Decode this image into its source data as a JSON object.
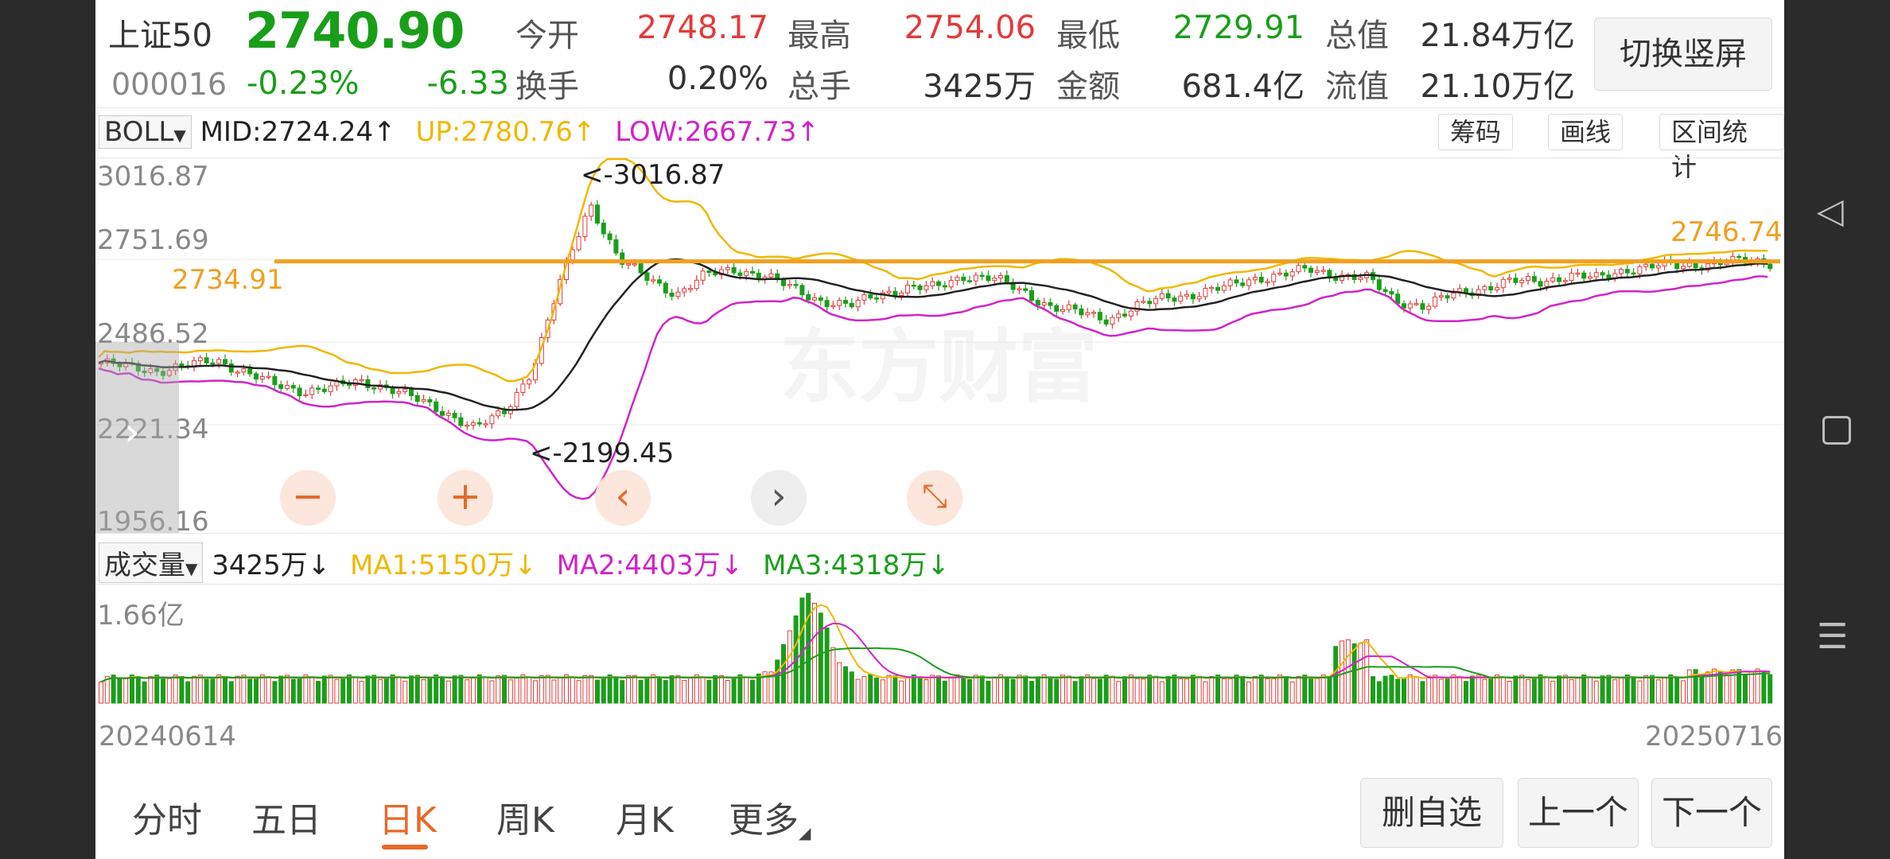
{
  "stock": {
    "name": "上证50",
    "price": "2740.90",
    "code": "000016",
    "change_pct": "-0.23%",
    "change": "-6.33",
    "stats": [
      {
        "label": "今开",
        "value": "2748.17",
        "color": "#e33a3a"
      },
      {
        "label": "最高",
        "value": "2754.06",
        "color": "#e33a3a"
      },
      {
        "label": "最低",
        "value": "2729.91",
        "color": "#1a9e1a"
      },
      {
        "label": "总值",
        "value": "21.84万亿",
        "color": "#333333"
      },
      {
        "label": "换手",
        "value": "0.20%",
        "color": "#333333"
      },
      {
        "label": "总手",
        "value": "3425万",
        "color": "#333333"
      },
      {
        "label": "金额",
        "value": "681.4亿",
        "color": "#333333"
      },
      {
        "label": "流值",
        "value": "21.10万亿",
        "color": "#333333"
      }
    ],
    "switch_label": "切换竖屏"
  },
  "indicator": {
    "selector": "BOLL",
    "mid": "MID:2724.24",
    "up": "UP:2780.76",
    "low": "LOW:2667.73",
    "arrow_up": "↑",
    "buttons": [
      "筹码",
      "画线",
      "区间统计"
    ]
  },
  "kchart": {
    "y_ticks": [
      "3016.87",
      "2751.69",
      "2486.52",
      "2221.34",
      "1956.16"
    ],
    "high_label": "<-3016.87",
    "low_label": "<-2199.45",
    "hline_left": "2734.91",
    "hline_right": "2746.74",
    "watermark": "东方财富"
  },
  "volume": {
    "selector": "成交量",
    "value": "3425万",
    "ma1": "MA1:5150万",
    "ma2": "MA2:4403万",
    "ma3": "MA3:4318万",
    "arrow_down": "↓",
    "y_top": "1.66亿",
    "date_start": "20240614",
    "date_end": "20250716"
  },
  "controls": {
    "zoom_out": "−",
    "zoom_in": "+",
    "prev": "‹",
    "next": "›",
    "collapse": "⤡"
  },
  "tabs": [
    "分时",
    "五日",
    "日K",
    "周K",
    "月K",
    "更多"
  ],
  "active_tab": "日K",
  "actions": {
    "remove": "删自选",
    "prev": "上一个",
    "next": "下一个"
  },
  "colors": {
    "up": "#e33a3a",
    "down": "#1a9e1a",
    "accent": "#e8692a",
    "mid": "#222222",
    "upper": "#f0b800",
    "lower": "#d024c8",
    "hline": "#f0a020"
  },
  "chart_data": {
    "type": "candlestick",
    "x_range": [
      "20240614",
      "20250716"
    ],
    "ylim": [
      1956.16,
      3016.87
    ],
    "series": [
      {
        "name": "MID",
        "last": 2724.24
      },
      {
        "name": "UP",
        "last": 2780.76
      },
      {
        "name": "LOW",
        "last": 2667.73
      }
    ],
    "close_path": [
      2420,
      2405,
      2395,
      2410,
      2430,
      2390,
      2350,
      2330,
      2340,
      2360,
      2340,
      2300,
      2260,
      2210,
      2260,
      2400,
      2690,
      2930,
      2750,
      2690,
      2640,
      2700,
      2720,
      2700,
      2660,
      2620,
      2600,
      2640,
      2660,
      2660,
      2700,
      2690,
      2650,
      2600,
      2580,
      2560,
      2600,
      2630,
      2640,
      2660,
      2690,
      2700,
      2720,
      2700,
      2690,
      2620,
      2600,
      2640,
      2660,
      2680,
      2680,
      2700,
      2690,
      2720,
      2730,
      2730,
      2740,
      2745,
      2741
    ]
  }
}
